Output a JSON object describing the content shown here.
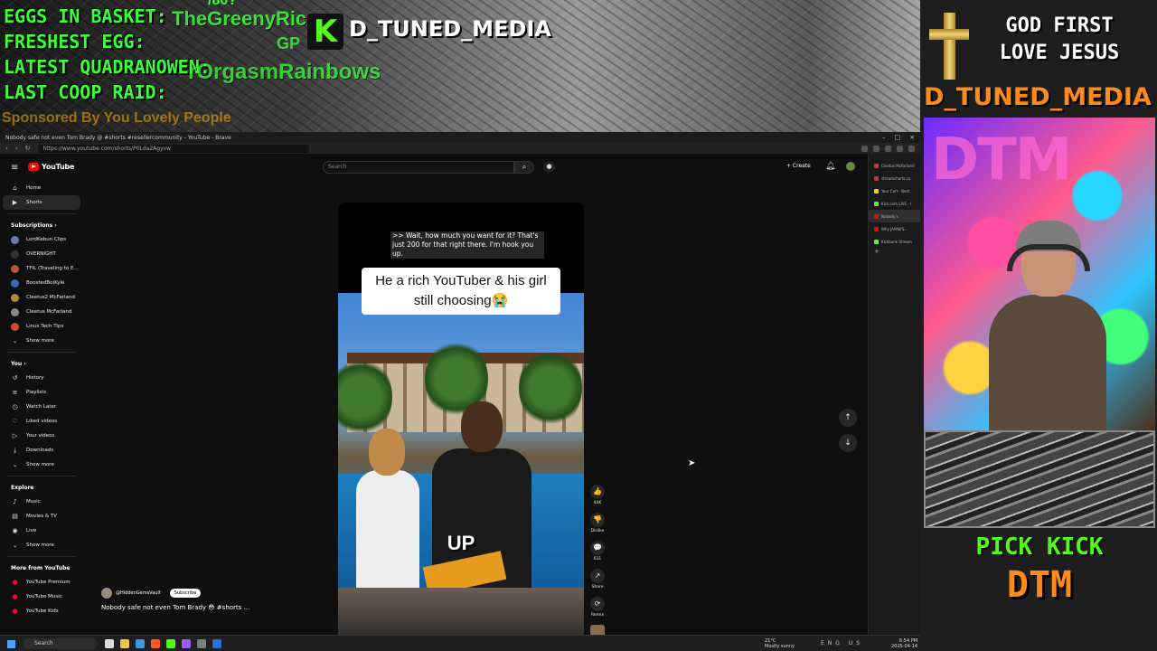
{
  "overlay": {
    "stat_lines": [
      "EGGS IN BASKET:",
      "FRESHEST EGG:",
      "LATEST QUADRANOWEN:",
      "LAST COOP RAID:"
    ],
    "raid_number": "/80?",
    "raid_name": "TheGreenyRic",
    "raid_sub": "GP",
    "rainbow_name": "rOrgasmRainbows",
    "sponsor": "Sponsored By You Lovely People",
    "kick_badge": "K",
    "kick_name": "D_TUNED_MEDIA",
    "god_first_line1": "GOD FIRST",
    "god_first_line2": "LOVE JESUS",
    "dtm_handle": "D_TUNED_MEDIA",
    "webcam_wall_text": "DTM",
    "pick_kick": "PICK KICK",
    "dtm_big": "DTM"
  },
  "browser": {
    "title": "Nobody safe not even Tom Brady @ #shorts #resellercommunity - YouTube - Brave",
    "url": "https://www.youtube.com/shorts/P0Lda2Agyvw",
    "nav_back": "‹",
    "nav_forward": "›",
    "nav_reload": "↻",
    "window_controls": [
      "–",
      "□",
      "×"
    ]
  },
  "youtube": {
    "logo_text": "YouTube",
    "search_placeholder": "Search",
    "create_label": "+ Create",
    "sidebar": {
      "main": [
        {
          "icon": "⌂",
          "label": "Home"
        },
        {
          "icon": "▶",
          "label": "Shorts"
        }
      ],
      "subscriptions_title": "Subscriptions  ›",
      "subscriptions": [
        {
          "label": "LordKebun Clips",
          "color": "#6a7ab0"
        },
        {
          "label": "OVERNIGHT",
          "color": "#333333"
        },
        {
          "label": "TFIL (Traveling to E...",
          "color": "#b05a3a"
        },
        {
          "label": "BoostedBoiKyle",
          "color": "#3a6ab0"
        },
        {
          "label": "Cleetus2 McFarland",
          "color": "#b08a3a"
        },
        {
          "label": "Cleetus McFarland",
          "color": "#8a8a8a"
        },
        {
          "label": "Linus Tech Tips",
          "color": "#d04a2a"
        }
      ],
      "show_more": "Show more",
      "you_title": "You  ›",
      "you": [
        {
          "icon": "↺",
          "label": "History"
        },
        {
          "icon": "≡",
          "label": "Playlists"
        },
        {
          "icon": "◷",
          "label": "Watch Later"
        },
        {
          "icon": "♡",
          "label": "Liked videos"
        },
        {
          "icon": "▷",
          "label": "Your videos"
        },
        {
          "icon": "⤓",
          "label": "Downloads"
        }
      ],
      "show_more_2": "Show more",
      "explore_title": "Explore",
      "explore": [
        {
          "icon": "♪",
          "label": "Music"
        },
        {
          "icon": "▤",
          "label": "Movies & TV"
        },
        {
          "icon": "◉",
          "label": "Live"
        }
      ],
      "show_more_3": "Show more",
      "more_title": "More from YouTube",
      "more": [
        {
          "label": "YouTube Premium"
        },
        {
          "label": "YouTube Music"
        },
        {
          "label": "YouTube Kids"
        }
      ]
    },
    "short": {
      "cc_text": ">> Wait, how much you want for it? That's just 200 for that right there. I'm hook you up.",
      "caption": "He a rich YouTuber & his girl still choosing😭",
      "overlay_word": "UP",
      "progress": 0.12,
      "channel": "@HiddenGemsVault",
      "subscribe_label": "Subscribe",
      "title": "Nobody safe not even Tom Brady 😳 #shorts ...",
      "actions": [
        {
          "icon": "👍",
          "label": "44K"
        },
        {
          "icon": "👎",
          "label": "Dislike"
        },
        {
          "icon": "💬",
          "label": "611"
        },
        {
          "icon": "↗",
          "label": "Share"
        },
        {
          "icon": "⟳",
          "label": "Remix"
        }
      ]
    },
    "nav_up": "↑",
    "nav_down": "↓",
    "cursor": "➤"
  },
  "tabs": [
    {
      "label": "Cleetus McFarland",
      "color": "#cc3333"
    },
    {
      "label": "streamcharts.co",
      "color": "#cc3333"
    },
    {
      "label": "Your Cart - Best",
      "color": "#ffcc00"
    },
    {
      "label": "Kick.com LIVE - I",
      "color": "#53fc18"
    },
    {
      "label": "Nobody s",
      "color": "#ff0000",
      "selected": true
    },
    {
      "label": "Why JAPAN'S...",
      "color": "#ff0000"
    },
    {
      "label": "Kickbank Stream",
      "color": "#53fc18"
    }
  ],
  "new_tab": "+",
  "taskbar": {
    "search": "Search",
    "weather_temp": "21°C",
    "weather_desc": "Mostly sunny",
    "tray": "ENG US",
    "time": "6:54 PM",
    "date": "2025-04-14",
    "app_colors": [
      "#dddddd",
      "#f2c14e",
      "#3a96dd",
      "#ff5a1f",
      "#53fc18",
      "#9b59ff",
      "#7e7e7e",
      "#2d6cdf"
    ]
  }
}
